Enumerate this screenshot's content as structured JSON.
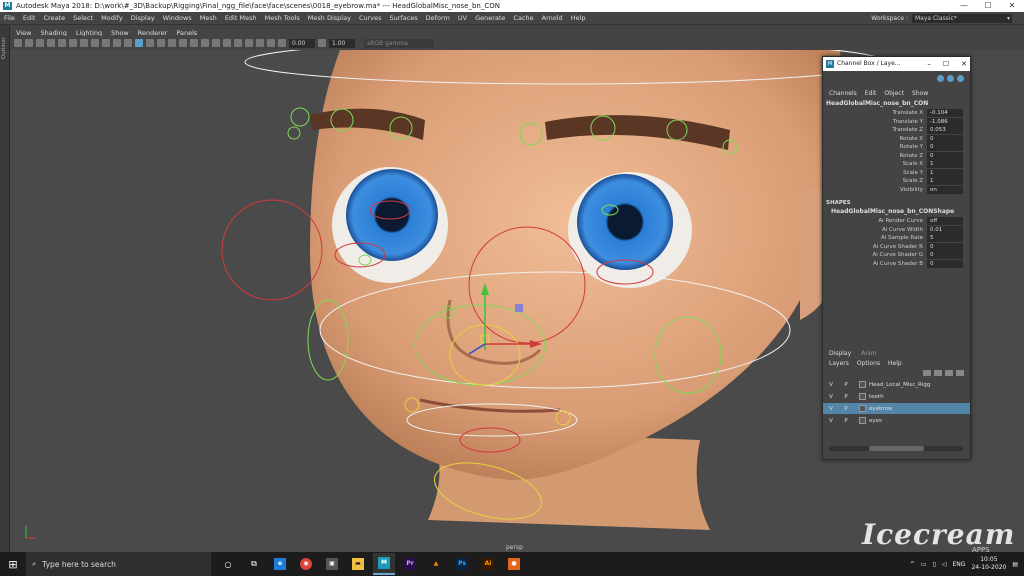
{
  "window": {
    "title": "Autodesk Maya 2018: D:\\work\\#_3D\\Backup\\Rigging\\Final_ngg_file\\face\\face\\scenes\\0018_eyebrow.ma*   ---   HeadGlobalMisc_nose_bn_CON",
    "minimize": "—",
    "maximize": "☐",
    "close": "✕"
  },
  "menubar": [
    "File",
    "Edit",
    "Create",
    "Select",
    "Modify",
    "Display",
    "Windows",
    "Mesh",
    "Edit Mesh",
    "Mesh Tools",
    "Mesh Display",
    "Curves",
    "Surfaces",
    "Deform",
    "UV",
    "Generate",
    "Cache",
    "Arnold",
    "Help"
  ],
  "workspace": {
    "label": "Workspace :",
    "value": "Maya Classic*"
  },
  "statusline": {
    "value1": "0.00",
    "value2": "1.00",
    "colorspace": "sRGB gamma"
  },
  "outliner_label": "Outliner",
  "panel_menu": [
    "View",
    "Shading",
    "Lighting",
    "Show",
    "Renderer",
    "Panels"
  ],
  "viewport": {
    "camera_label": "persp",
    "accent_colors": {
      "skin": "#e8b08a",
      "iris": "#2f7fd1",
      "control_green": "#7ed957",
      "control_red": "#d03a3a",
      "control_yellow": "#e6d23a",
      "control_white": "#f2f2f2"
    }
  },
  "watermark": {
    "text": "Icecream",
    "sub": "APPS"
  },
  "channel_box": {
    "title": "Channel Box / Laye...",
    "menu": [
      "Channels",
      "Edit",
      "Object",
      "Show"
    ],
    "object_name": "HeadGlobalMisc_nose_bn_CON",
    "attributes": [
      {
        "name": "Translate X",
        "value": "-0.104"
      },
      {
        "name": "Translate Y",
        "value": "-1.086"
      },
      {
        "name": "Translate Z",
        "value": "0.053"
      },
      {
        "name": "Rotate X",
        "value": "0"
      },
      {
        "name": "Rotate Y",
        "value": "0"
      },
      {
        "name": "Rotate Z",
        "value": "0"
      },
      {
        "name": "Scale X",
        "value": "1"
      },
      {
        "name": "Scale Y",
        "value": "1"
      },
      {
        "name": "Scale Z",
        "value": "1"
      },
      {
        "name": "Visibility",
        "value": "on"
      }
    ],
    "shapes_header": "SHAPES",
    "shape_name": "HeadGlobalMisc_nose_bn_CONShape",
    "shape_attributes": [
      {
        "name": "Ai Render Curve",
        "value": "off"
      },
      {
        "name": "Ai Curve Width",
        "value": "0.01"
      },
      {
        "name": "Ai Sample Rate",
        "value": "5"
      },
      {
        "name": "Ai Curve Shader R",
        "value": "0"
      },
      {
        "name": "Ai Curve Shader G",
        "value": "0"
      },
      {
        "name": "Ai Curve Shader B",
        "value": "0"
      }
    ]
  },
  "layer_editor": {
    "tabs": [
      "Display",
      "Anim"
    ],
    "menu": [
      "Layers",
      "Options",
      "Help"
    ],
    "layers": [
      {
        "v": "V",
        "p": "P",
        "name": "Head_Local_Misc_Rigg",
        "selected": false
      },
      {
        "v": "V",
        "p": "P",
        "name": "teeth",
        "selected": false
      },
      {
        "v": "V",
        "p": "P",
        "name": "eyebrow",
        "selected": true
      },
      {
        "v": "V",
        "p": "P",
        "name": "eyes",
        "selected": false
      }
    ]
  },
  "taskbar": {
    "search_placeholder": "Type here to search",
    "apps": [
      {
        "icon": "task-view-icon",
        "label": "⧉"
      },
      {
        "icon": "edge-icon",
        "label": "e"
      },
      {
        "icon": "chrome-icon",
        "label": "◉"
      },
      {
        "icon": "store-icon",
        "label": "▣"
      },
      {
        "icon": "folder-icon",
        "label": "▬"
      },
      {
        "icon": "maya-icon",
        "label": "M"
      },
      {
        "icon": "premiere-icon",
        "label": "Pr"
      },
      {
        "icon": "vlc-icon",
        "label": "▲"
      },
      {
        "icon": "photoshop-icon",
        "label": "Ps"
      },
      {
        "icon": "illustrator-icon",
        "label": "Ai"
      },
      {
        "icon": "recorder-icon",
        "label": "●"
      }
    ],
    "lang": "ENG",
    "time": "10:05",
    "date": "24-10-2020"
  }
}
